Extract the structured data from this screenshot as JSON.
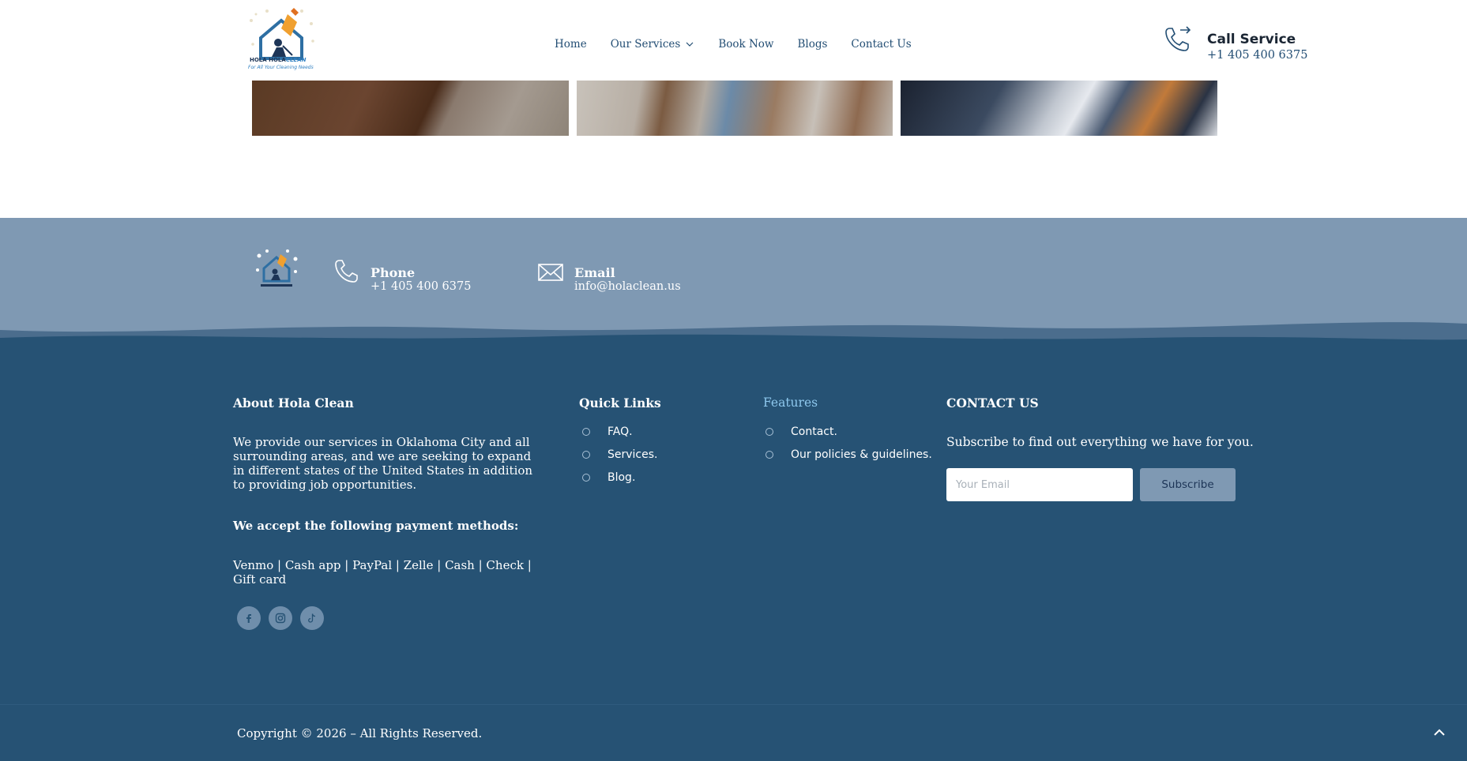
{
  "header": {
    "logo_text_bold": "HOLA HOLA",
    "logo_text_accent": "CLEAN",
    "logo_tagline": "For All Your Cleaning Needs",
    "nav": [
      {
        "label": "Home"
      },
      {
        "label": "Our Services",
        "has_dropdown": true
      },
      {
        "label": "Book Now"
      },
      {
        "label": "Blogs"
      },
      {
        "label": "Contact Us"
      }
    ],
    "call_title": "Call Service",
    "call_number": "+1 405 400 6375"
  },
  "footer_top": {
    "phone_label": "Phone",
    "phone_value": "+1 405 400 6375",
    "email_label": "Email",
    "email_value": "info@holaclean.us"
  },
  "footer": {
    "about": {
      "title": "About Hola Clean",
      "text": "We provide our services in Oklahoma City and all surrounding areas, and we are seeking to expand in different states of the United States in addition to providing job opportunities.",
      "payment_title": "We accept the following payment methods:",
      "payment_methods": "Venmo | Cash app | PayPal | Zelle | Cash | Check | Gift card"
    },
    "quick_links": {
      "title": "Quick Links",
      "items": [
        "FAQ.",
        "Services.",
        "Blog."
      ]
    },
    "features": {
      "title": "Features",
      "items": [
        "Contact.",
        "Our policies & guidelines."
      ]
    },
    "contact": {
      "title": "CONTACT US",
      "subscribe_text": "Subscribe to find out everything we have for you.",
      "email_placeholder": "Your Email",
      "subscribe_button": "Subscribe"
    },
    "social": [
      "facebook-icon",
      "instagram-icon",
      "tiktok-icon"
    ],
    "copyright": "Copyright © 2026 – All Rights Reserved."
  },
  "colors": {
    "band": "#7f99b3",
    "footer": "#265274",
    "accent": "#8ec8ee",
    "nav_text": "#234e74"
  }
}
